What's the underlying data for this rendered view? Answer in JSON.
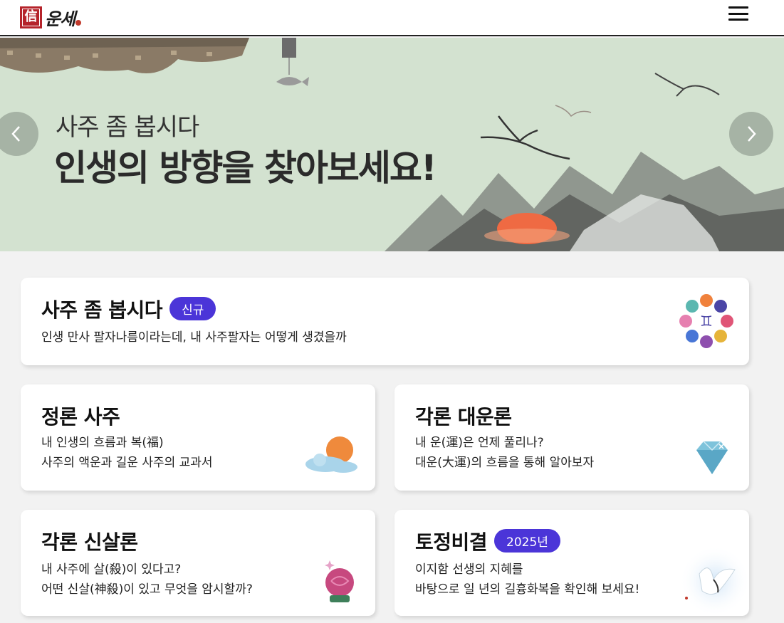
{
  "header": {
    "logo_seal": "信",
    "logo_text": "운세",
    "menu_icon": "hamburger-menu-icon"
  },
  "banner": {
    "subtitle": "사주 좀 봅시다",
    "title": "인생의 방향을 찾아보세요!",
    "prev_icon": "chevron-left-icon",
    "next_icon": "chevron-right-icon"
  },
  "cards": {
    "saju": {
      "title": "사주 좀 봅시다",
      "badge": "신규",
      "desc1": "인생 만사 팔자나름이라는데, 내 사주팔자는 어떻게 생겼을까",
      "icon": "zodiac-circle-icon"
    },
    "jeongron": {
      "title": "정론 사주",
      "desc1": "내 인생의 흐름과 복(福)",
      "desc2": "사주의 액운과 길운 사주의 교과서",
      "icon": "sun-cloud-icon"
    },
    "daeun": {
      "title": "각론 대운론",
      "desc1": "내 운(運)은 언제 풀리나?",
      "desc2": "대운(大運)의 흐름을 통해 알아보자",
      "icon": "diamond-icon"
    },
    "sinsal": {
      "title": "각론 신살론",
      "desc1": "내 사주에 살(殺)이 있다고?",
      "desc2": "어떤 신살(神殺)이 있고 무엇을 암시할까?",
      "icon": "crystal-ball-icon"
    },
    "tojeong": {
      "title": "토정비결",
      "badge": "2025년",
      "desc1": "이지함 선생의 지혜를",
      "desc2": "바탕으로 일 년의 길흉화복을 확인해 보세요!",
      "icon": "crane-icon"
    }
  },
  "colors": {
    "badge": "#4b35d8",
    "banner_bg": "#d3e2d0",
    "page_bg": "#f2f2f2",
    "seal": "#b5232a"
  }
}
